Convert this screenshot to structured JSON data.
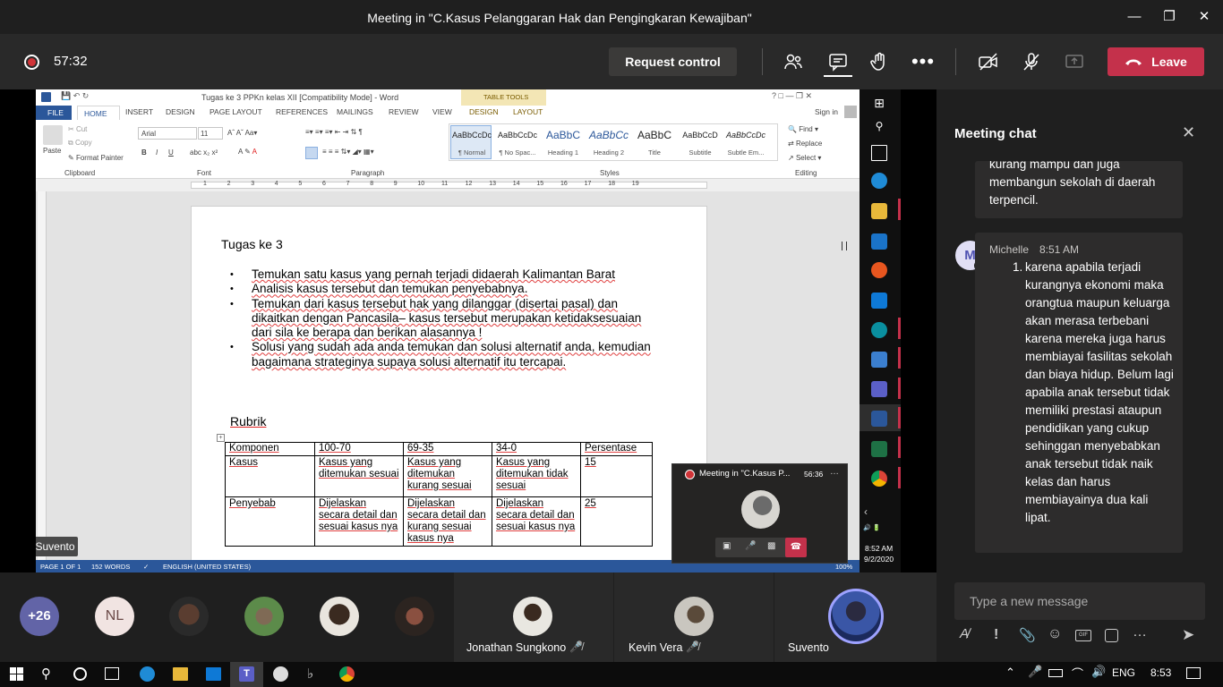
{
  "window": {
    "title": "Meeting in \"C.Kasus Pelanggaran Hak dan Pengingkaran Kewajiban\""
  },
  "toolbar": {
    "timer": "57:32",
    "request_control": "Request control",
    "leave": "Leave"
  },
  "word": {
    "title": "Tugas ke 3 PPKn kelas XII [Compatibility Mode] - Word",
    "table_tools": "TABLE TOOLS",
    "tabs": [
      "FILE",
      "HOME",
      "INSERT",
      "DESIGN",
      "PAGE LAYOUT",
      "REFERENCES",
      "MAILINGS",
      "REVIEW",
      "VIEW",
      "DESIGN",
      "LAYOUT"
    ],
    "sign_in": "Sign in",
    "clipboard": {
      "paste": "Paste",
      "cut": "Cut",
      "copy": "Copy",
      "format_painter": "Format Painter",
      "label": "Clipboard"
    },
    "font": {
      "name": "Arial",
      "size": "11",
      "label": "Font"
    },
    "paragraph_label": "Paragraph",
    "styles": [
      {
        "preview": "AaBbCcDc",
        "name": "¶ Normal"
      },
      {
        "preview": "AaBbCcDc",
        "name": "¶ No Spac..."
      },
      {
        "preview": "AaBbC",
        "name": "Heading 1"
      },
      {
        "preview": "AaBbCc",
        "name": "Heading 2"
      },
      {
        "preview": "AaBbC",
        "name": "Title"
      },
      {
        "preview": "AaBbCcD",
        "name": "Subtitle"
      },
      {
        "preview": "AaBbCcDc",
        "name": "Subtle Em..."
      }
    ],
    "styles_label": "Styles",
    "editing": {
      "find": "Find",
      "replace": "Replace",
      "select": "Select",
      "label": "Editing"
    },
    "doc": {
      "heading": "Tugas ke 3",
      "bullets": [
        "Temukan satu kasus yang pernah terjadi didaerah Kalimantan Barat",
        "Analisis kasus tersebut dan temukan penyebabnya.",
        "Temukan dari kasus tersebut hak yang dilanggar (disertai pasal) dan dikaitkan dengan Pancasila– kasus tersebut merupakan ketidaksesuaian dari sila ke berapa dan berikan alasannya !",
        "Solusi yang sudah ada anda temukan dan solusi alternatif anda, kemudian bagaimana strateginya supaya solusi alternatif itu tercapai."
      ],
      "rubrik": "Rubrik",
      "table_headers": [
        "Komponen",
        "100-70",
        "69-35",
        "34-0",
        "Persentase"
      ],
      "table_rows": [
        [
          "Kasus",
          "Kasus yang ditemukan sesuai",
          "Kasus yang ditemukan kurang sesuai",
          "Kasus yang ditemukan tidak sesuai",
          "15"
        ],
        [
          "Penyebab",
          "Dijelaskan secara detail dan sesuai kasus nya",
          "Dijelaskan secara detail dan kurang sesuai kasus nya",
          "Dijelaskan secara detail dan sesuai kasus nya",
          "25"
        ]
      ]
    },
    "status": {
      "page": "PAGE 1 OF 1",
      "words": "152 WORDS",
      "lang": "ENGLISH (UNITED STATES)",
      "zoom": "100%"
    },
    "presenter_label": "Suvento"
  },
  "vtask": {
    "time": "8:52 AM",
    "date": "9/2/2020"
  },
  "mini": {
    "title": "Meeting in \"C.Kasus P...",
    "timer": "56:36"
  },
  "chat": {
    "title": "Meeting chat",
    "prev_text": "kurang mampu dan juga membangun sekolah di daerah terpencil.",
    "sender": "Michelle",
    "sender_initial": "M",
    "time": "8:51 AM",
    "number": "1.",
    "body": "karena apabila terjadi kurangnya ekonomi maka orangtua maupun keluarga akan merasa terbebani karena mereka juga harus membiayai fasilitas sekolah dan biaya hidup. Belum lagi apabila anak tersebut tidak memiliki prestasi ataupun pendidikan yang cukup sehinggan menyebabkan anak tersebut tidak naik kelas dan harus membiayainya dua kali lipat.",
    "placeholder": "Type a new message"
  },
  "participants": {
    "more": "+26",
    "nl": "NL",
    "named": [
      "Jonathan Sungkono",
      "Kevin Vera",
      "Suvento"
    ]
  },
  "taskbar": {
    "lang": "ENG",
    "time": "8:53"
  },
  "colors": {
    "leave": "#c4314b",
    "word_blue": "#2b579a",
    "teams_purple": "#6264a7"
  }
}
